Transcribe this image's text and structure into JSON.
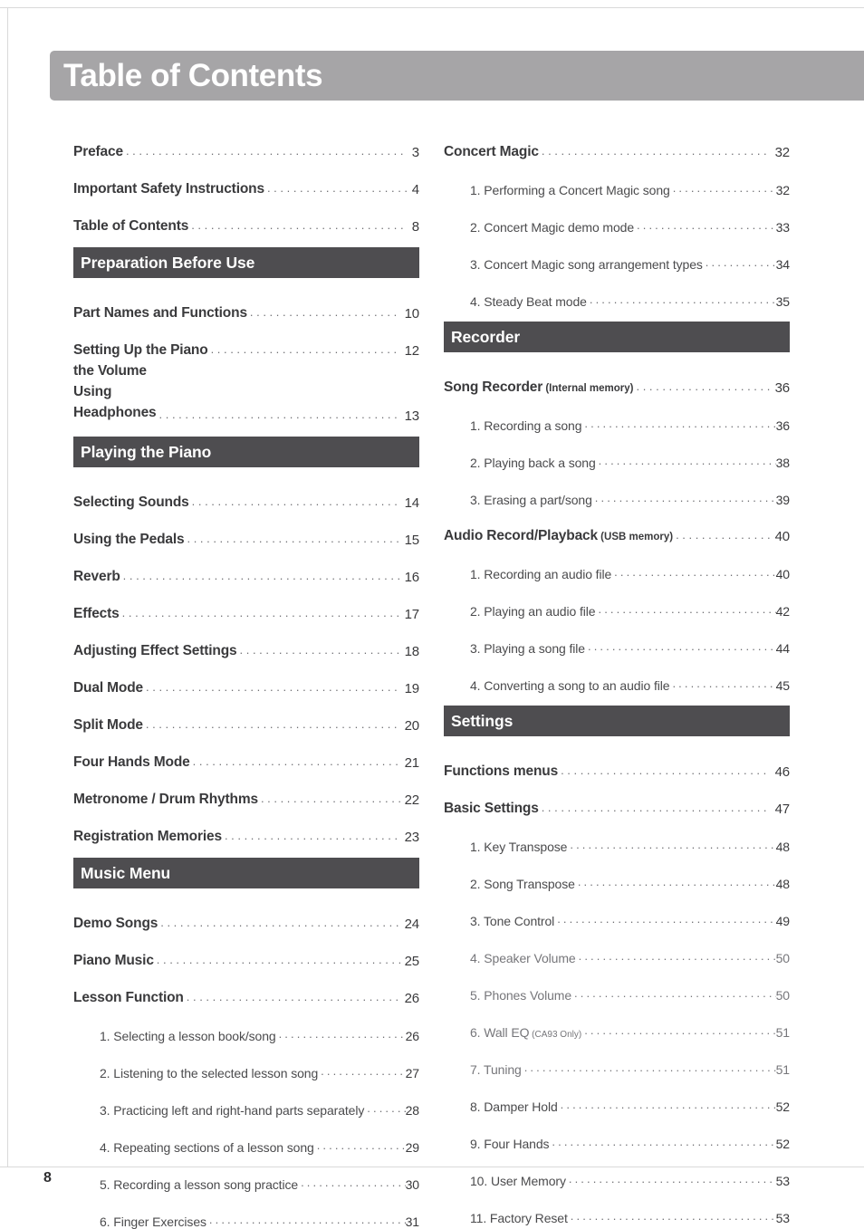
{
  "header": {
    "title": "Table of Contents",
    "banner_color": "#a6a5a7"
  },
  "section_bar_color": "#4e4d50",
  "folio": "8",
  "columns": {
    "left": [
      {
        "kind": "entry",
        "level": 1,
        "label": "Preface",
        "page": "3"
      },
      {
        "kind": "entry",
        "level": 1,
        "label": "Important Safety Instructions",
        "page": "4"
      },
      {
        "kind": "entry",
        "level": 1,
        "label": "Table of Contents",
        "page": "8"
      },
      {
        "kind": "section",
        "label": "Preparation Before Use"
      },
      {
        "kind": "entry",
        "level": 1,
        "label": "Part Names and Functions",
        "page": "10"
      },
      {
        "kind": "entry",
        "level": 1,
        "label": "Setting Up the Piano",
        "page": "12"
      },
      {
        "kind": "entry",
        "level": 1,
        "two_line": true,
        "label": "Adjusting the Volume\nUsing Headphones",
        "page": "13"
      },
      {
        "kind": "section",
        "label": "Playing the Piano"
      },
      {
        "kind": "entry",
        "level": 1,
        "label": "Selecting Sounds",
        "page": "14"
      },
      {
        "kind": "entry",
        "level": 1,
        "label": "Using the Pedals",
        "page": "15"
      },
      {
        "kind": "entry",
        "level": 1,
        "label": "Reverb",
        "page": "16"
      },
      {
        "kind": "entry",
        "level": 1,
        "label": "Effects",
        "page": "17"
      },
      {
        "kind": "entry",
        "level": 1,
        "label": "Adjusting Effect Settings",
        "page": "18"
      },
      {
        "kind": "entry",
        "level": 1,
        "label": "Dual Mode",
        "page": "19"
      },
      {
        "kind": "entry",
        "level": 1,
        "label": "Split Mode",
        "page": "20"
      },
      {
        "kind": "entry",
        "level": 1,
        "label": "Four Hands Mode",
        "page": "21"
      },
      {
        "kind": "entry",
        "level": 1,
        "label": "Metronome / Drum Rhythms",
        "page": "22"
      },
      {
        "kind": "entry",
        "level": 1,
        "label": "Registration Memories",
        "page": "23"
      },
      {
        "kind": "section",
        "label": "Music Menu"
      },
      {
        "kind": "entry",
        "level": 1,
        "label": "Demo Songs",
        "page": "24"
      },
      {
        "kind": "entry",
        "level": 1,
        "label": "Piano Music",
        "page": "25"
      },
      {
        "kind": "entry",
        "level": 1,
        "label": "Lesson Function",
        "page": "26"
      },
      {
        "kind": "entry",
        "level": 2,
        "label": "1. Selecting a lesson book/song",
        "page": "26"
      },
      {
        "kind": "entry",
        "level": 2,
        "label": "2. Listening to the selected lesson song",
        "page": "27"
      },
      {
        "kind": "entry",
        "level": 2,
        "label": "3. Practicing left and right-hand parts separately",
        "page": "28"
      },
      {
        "kind": "entry",
        "level": 2,
        "label": "4. Repeating sections of a lesson song",
        "page": "29"
      },
      {
        "kind": "entry",
        "level": 2,
        "label": "5. Recording a lesson song practice",
        "page": "30"
      },
      {
        "kind": "entry",
        "level": 2,
        "label": "6. Finger Exercises",
        "page": "31"
      }
    ],
    "right": [
      {
        "kind": "entry",
        "level": 1,
        "label": "Concert Magic",
        "page": "32"
      },
      {
        "kind": "entry",
        "level": 2,
        "label": "1. Performing a Concert Magic song",
        "page": "32"
      },
      {
        "kind": "entry",
        "level": 2,
        "label": "2. Concert Magic demo mode",
        "page": "33"
      },
      {
        "kind": "entry",
        "level": 2,
        "label": "3. Concert Magic song arrangement types",
        "page": "34"
      },
      {
        "kind": "entry",
        "level": 2,
        "label": "4. Steady Beat mode",
        "page": "35"
      },
      {
        "kind": "section",
        "label": "Recorder"
      },
      {
        "kind": "entry",
        "level": 1,
        "label": "Song Recorder",
        "note": "(Internal memory)",
        "page": "36"
      },
      {
        "kind": "entry",
        "level": 2,
        "label": "1. Recording a song",
        "page": "36"
      },
      {
        "kind": "entry",
        "level": 2,
        "label": "2. Playing back a song",
        "page": "38"
      },
      {
        "kind": "entry",
        "level": 2,
        "label": "3. Erasing a part/song",
        "page": "39"
      },
      {
        "kind": "entry",
        "level": 1,
        "label": "Audio Record/Playback",
        "note": "(USB memory)",
        "page": "40"
      },
      {
        "kind": "entry",
        "level": 2,
        "label": "1. Recording an audio file",
        "page": "40"
      },
      {
        "kind": "entry",
        "level": 2,
        "label": "2. Playing an audio file",
        "page": "42"
      },
      {
        "kind": "entry",
        "level": 2,
        "label": "3. Playing a song file",
        "page": "44"
      },
      {
        "kind": "entry",
        "level": 2,
        "label": "4. Converting a song to an audio file",
        "page": "45"
      },
      {
        "kind": "section",
        "label": "Settings"
      },
      {
        "kind": "entry",
        "level": 1,
        "label": "Functions menus",
        "page": "46"
      },
      {
        "kind": "entry",
        "level": 1,
        "label": "Basic Settings",
        "page": "47"
      },
      {
        "kind": "entry",
        "level": 2,
        "label": "1. Key Transpose",
        "page": "48"
      },
      {
        "kind": "entry",
        "level": 2,
        "label": "2. Song Transpose",
        "page": "48"
      },
      {
        "kind": "entry",
        "level": 2,
        "label": "3. Tone Control",
        "page": "49"
      },
      {
        "kind": "entry",
        "level": 2,
        "faded": true,
        "label": "4. Speaker Volume",
        "page": "50"
      },
      {
        "kind": "entry",
        "level": 2,
        "faded": true,
        "label": "5. Phones Volume",
        "page": "50"
      },
      {
        "kind": "entry",
        "level": 2,
        "faded": true,
        "label": "6. Wall EQ",
        "note": "(CA93 Only)",
        "page": "51"
      },
      {
        "kind": "entry",
        "level": 2,
        "faded": true,
        "label": "7. Tuning",
        "page": "51"
      },
      {
        "kind": "entry",
        "level": 2,
        "label": "8. Damper Hold",
        "page": "52"
      },
      {
        "kind": "entry",
        "level": 2,
        "label": "9. Four Hands",
        "page": "52"
      },
      {
        "kind": "entry",
        "level": 2,
        "label": "10. User Memory",
        "page": "53"
      },
      {
        "kind": "entry",
        "level": 2,
        "label": "11. Factory Reset",
        "page": "53"
      }
    ]
  }
}
